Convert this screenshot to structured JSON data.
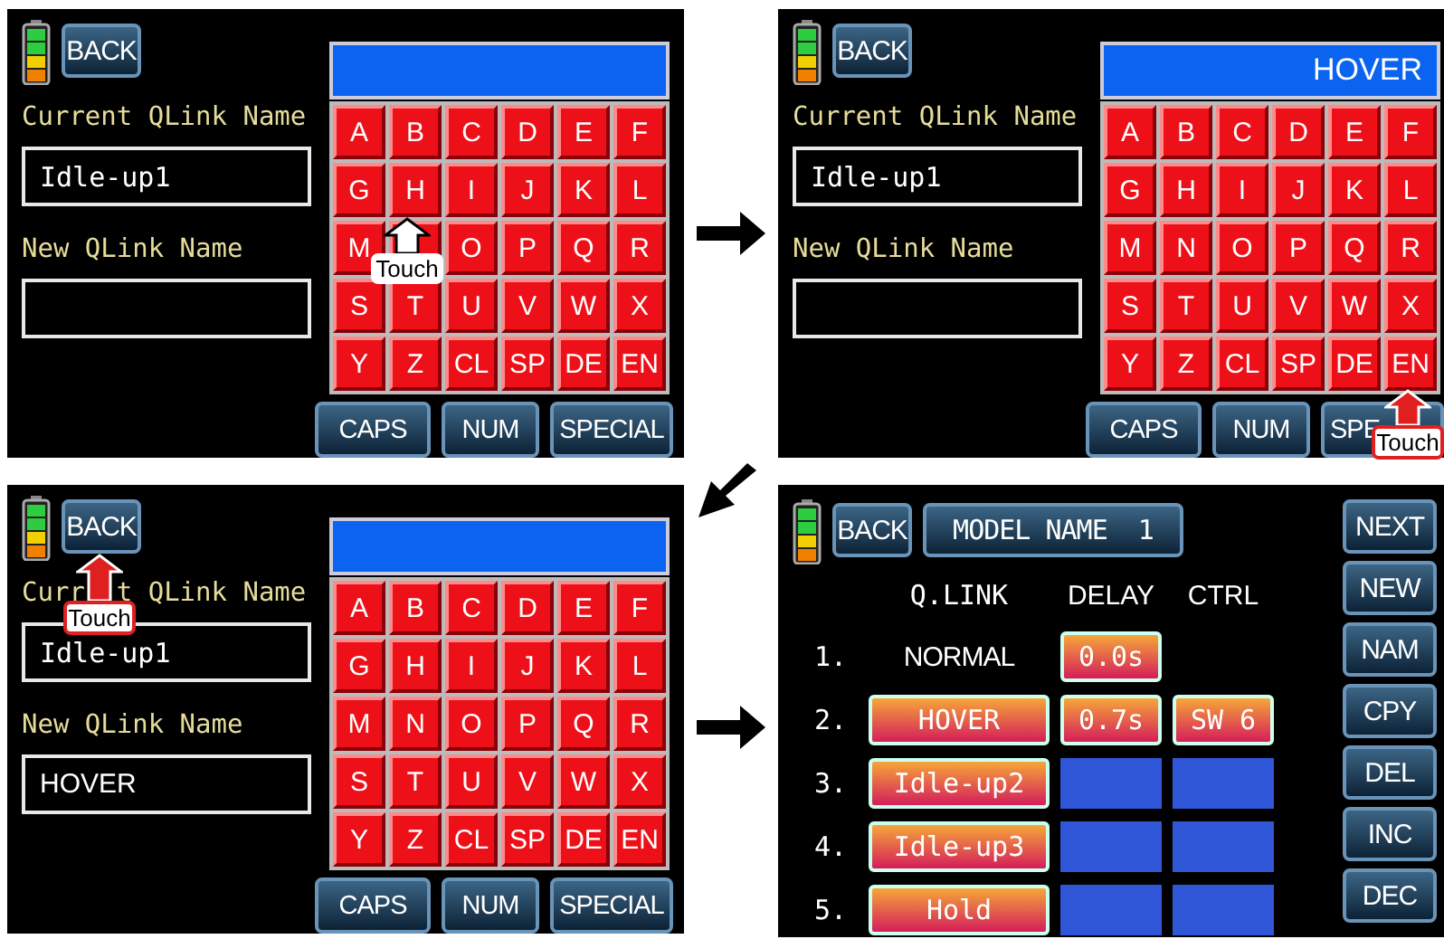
{
  "screens": [
    {
      "kind": "keyboard",
      "back": "BACK",
      "current_label": "Current QLink Name",
      "current_value": "Idle-up1",
      "new_label": "New QLink Name",
      "keys": [
        "A",
        "B",
        "C",
        "D",
        "E",
        "F",
        "G",
        "H",
        "I",
        "J",
        "K",
        "L",
        "M",
        "O",
        "P",
        "Q",
        "R",
        "S",
        "T",
        "U",
        "V",
        "W",
        "X",
        "Y",
        "Z",
        "CL",
        "SP",
        "DE",
        "EN"
      ],
      "buttons": [
        "CAPS",
        "NUM",
        "SPECIAL"
      ],
      "callout": {
        "text": "Touch"
      }
    },
    {
      "kind": "keyboard",
      "back": "BACK",
      "display": "HOVER",
      "current_label": "Current QLink Name",
      "current_value": "Idle-up1",
      "new_label": "New QLink Name",
      "keys": [
        "A",
        "B",
        "C",
        "D",
        "E",
        "F",
        "G",
        "H",
        "I",
        "J",
        "K",
        "L",
        "M",
        "N",
        "O",
        "P",
        "Q",
        "R",
        "S",
        "T",
        "U",
        "V",
        "W",
        "X",
        "Y",
        "Z",
        "CL",
        "SP",
        "DE",
        "EN"
      ],
      "buttons": [
        "CAPS",
        "NUM",
        "SPE"
      ],
      "callout": {
        "text": "Touch"
      }
    },
    {
      "kind": "keyboard",
      "back": "BACK",
      "current_label": [
        "Curr",
        "t QLink Name"
      ],
      "current_value": "Idle-up1",
      "new_label": "New QLink Name",
      "new_value": "HOVER",
      "keys": [
        "A",
        "B",
        "C",
        "D",
        "E",
        "F",
        "G",
        "H",
        "I",
        "J",
        "K",
        "L",
        "M",
        "N",
        "O",
        "P",
        "Q",
        "R",
        "S",
        "T",
        "U",
        "V",
        "W",
        "X",
        "Y",
        "Z",
        "CL",
        "SP",
        "DE",
        "EN"
      ],
      "buttons": [
        "CAPS",
        "NUM",
        "SPECIAL"
      ],
      "callout": {
        "text": "Touch"
      }
    },
    {
      "kind": "qlink",
      "back": "BACK",
      "title": "MODEL NAME  1",
      "columns": [
        "Q.LINK",
        "DELAY",
        "CTRL"
      ],
      "rows": [
        {
          "number": "1.",
          "qlink": {
            "kind": "label",
            "text": "NORMAL"
          },
          "delay": {
            "kind": "button",
            "text": "0.0s"
          },
          "ctrl": {
            "kind": "none"
          }
        },
        {
          "number": "2.",
          "qlink": {
            "kind": "button",
            "text": "HOVER"
          },
          "delay": {
            "kind": "button",
            "text": "0.7s"
          },
          "ctrl": {
            "kind": "button",
            "text": "SW 6"
          }
        },
        {
          "number": "3.",
          "qlink": {
            "kind": "button",
            "text": "Idle-up2"
          },
          "delay": {
            "kind": "blank"
          },
          "ctrl": {
            "kind": "blank"
          }
        },
        {
          "number": "4.",
          "qlink": {
            "kind": "button",
            "text": "Idle-up3"
          },
          "delay": {
            "kind": "blank"
          },
          "ctrl": {
            "kind": "blank"
          }
        },
        {
          "number": "5.",
          "qlink": {
            "kind": "button",
            "text": "Hold"
          },
          "delay": {
            "kind": "blank"
          },
          "ctrl": {
            "kind": "blank"
          }
        }
      ],
      "side_buttons": [
        "NEXT",
        "NEW",
        "NAM",
        "CPY",
        "DEL",
        "INC",
        "DEC"
      ]
    }
  ],
  "arrows": [
    {
      "kind": "right"
    },
    {
      "kind": "down-left"
    },
    {
      "kind": "right"
    }
  ]
}
